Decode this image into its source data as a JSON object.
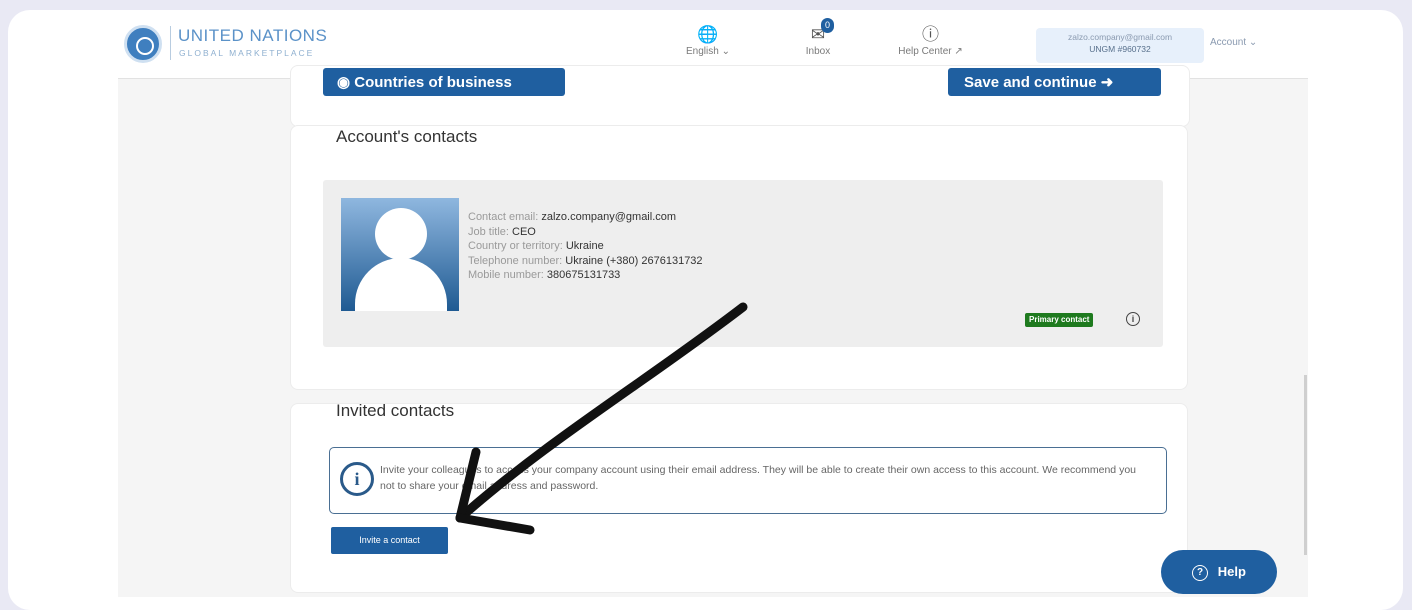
{
  "header": {
    "logo_title": "UNITED NATIONS",
    "logo_subtitle": "GLOBAL MARKETPLACE",
    "language": "English",
    "inbox_label": "Inbox",
    "inbox_count": "0",
    "help_label": "Help Center",
    "user_email": "zalzo.company@gmail.com",
    "user_id": "UNGM #960732",
    "account_label": "Account"
  },
  "buttons": {
    "countries": "Countries of business",
    "save": "Save and continue",
    "invite": "Invite a contact",
    "help_fab": "Help"
  },
  "accounts_section": {
    "title": "Account's contacts",
    "contact": {
      "email_label": "Contact email:",
      "email": "zalzo.company@gmail.com",
      "job_label": "Job title:",
      "job": "CEO",
      "country_label": "Country or territory:",
      "country": "Ukraine",
      "phone_label": "Telephone number:",
      "phone": "Ukraine (+380) 2676131732",
      "mobile_label": "Mobile number:",
      "mobile": "380675131733",
      "primary_badge": "Primary contact"
    }
  },
  "invited_section": {
    "title": "Invited contacts",
    "info": "Invite your colleagues to access your company account using their email address. They will be able to create their own access to this account. We recommend you not to share your email address and password."
  },
  "colors": {
    "brand": "#1f5fa0",
    "primary_badge": "#1e7a1e"
  }
}
